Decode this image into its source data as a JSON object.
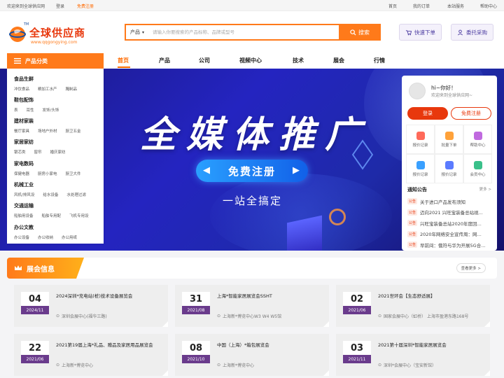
{
  "topbar": {
    "welcome": "欢迎来到全球供应网",
    "login": "登录",
    "register": "免费注册",
    "links": [
      "首页",
      "我的订单",
      "本站服务",
      "帮助中心"
    ]
  },
  "header": {
    "logo_text": "全球供应商",
    "logo_sub": "www.qqgongying.com",
    "logo_tm": "TM",
    "search": {
      "category": "产品",
      "placeholder": "请输入你要搜索的产品标称、品牌或型号",
      "button": "搜索"
    },
    "quick_order": "快速下单",
    "entrust": "委托采购"
  },
  "nav": {
    "category_title": "产品分类",
    "items": [
      "首页",
      "产品",
      "公司",
      "视频中心",
      "技术",
      "展会",
      "行情"
    ],
    "active_index": 0
  },
  "sidebar": {
    "groups": [
      {
        "title": "食品生鲜",
        "subs": [
          "冲饮食品",
          "粮加工水产",
          "腌制品"
        ]
      },
      {
        "title": "鞋包配饰",
        "subs": [
          "表",
          "耳性",
          "发饰/头饰"
        ]
      },
      {
        "title": "建材家装",
        "subs": [
          "餐厅家具",
          "场地户外材",
          "厨卫五金"
        ]
      },
      {
        "title": "家居家纺",
        "subs": [
          "银芯类",
          "窗帘",
          "婚庆家纺"
        ]
      },
      {
        "title": "家电数码",
        "subs": [
          "保健电器",
          "厨房小家电",
          "厨卫大件"
        ]
      },
      {
        "title": "机械工业",
        "subs": [
          "风机/排风设",
          "给水设备",
          "水处理过滤"
        ]
      },
      {
        "title": "交通运输",
        "subs": [
          "船舶用设备",
          "船舶专用配",
          "飞机专用设"
        ]
      },
      {
        "title": "办公文教",
        "subs": [
          "办公设备",
          "办公收纳",
          "办公用纸"
        ]
      }
    ]
  },
  "banner": {
    "headline": "全媒体推广",
    "register_button": "免费注册",
    "subtitle": "一站全搞定"
  },
  "user_panel": {
    "greeting": "hi~你好！",
    "welcome": "欢迎来到全球供应网~",
    "login": "登录",
    "register": "免费注册",
    "quick_links": [
      {
        "label": "报价记录",
        "icon": "quote-icon",
        "color": "#ff6a5a"
      },
      {
        "label": "批量下单",
        "icon": "cart-icon",
        "color": "#ffa23a"
      },
      {
        "label": "帮助中心",
        "icon": "help-icon",
        "color": "#c06adf"
      },
      {
        "label": "报价记录",
        "icon": "record-icon",
        "color": "#3aa0ff"
      },
      {
        "label": "报价记录",
        "icon": "chat-icon",
        "color": "#5b7bff"
      },
      {
        "label": "会员中心",
        "icon": "member-icon",
        "color": "#3ac08a"
      }
    ],
    "notice_title": "通知公告",
    "notice_more": "更多 >",
    "notice_tag": "公告",
    "notices": [
      "关于进口产品发布须知",
      "迈向2021 兴旺宝装备总站视...",
      "兴旺宝装备总站2020年度回...",
      "2020年网络安全宣传周：网...",
      "早前间：俄符与华为开展5G合..."
    ]
  },
  "expo": {
    "title": "展会信息",
    "more": "查看更多 >",
    "cards": [
      {
        "day": "04",
        "ym": "2024/11",
        "name": "2024深圳*充电站(桩)技术设备展览会",
        "loc": "深圳会展中心(福华三路)"
      },
      {
        "day": "31",
        "ym": "2021/08",
        "name": "上海*智能家居展览会SSHT",
        "loc": "上海新*博览中心W3 W4 W5馆"
      },
      {
        "day": "02",
        "ym": "2021/06",
        "name": "2021世环会【生态舒适展】",
        "loc": "国家会展中心（虹桥） 上海市盈港东路168号"
      },
      {
        "day": "22",
        "ym": "2021/06",
        "name": "2021第19届上海*礼品、赠品及家居用品展览会",
        "loc": "上海新*博览中心"
      },
      {
        "day": "08",
        "ym": "2021/10",
        "name": "中国（上海）*箱包展览会",
        "loc": "上海新*博览中心"
      },
      {
        "day": "03",
        "ym": "2021/11",
        "name": "2021第十届深圳*智能家居展览会",
        "loc": "深圳*会展中心（宝安新馆）"
      }
    ]
  },
  "colors": {
    "brand": "#ff7a1a",
    "brand_red": "#e8380d",
    "date_badge": "#6a3b8c",
    "banner_blue": "#2424c0"
  }
}
